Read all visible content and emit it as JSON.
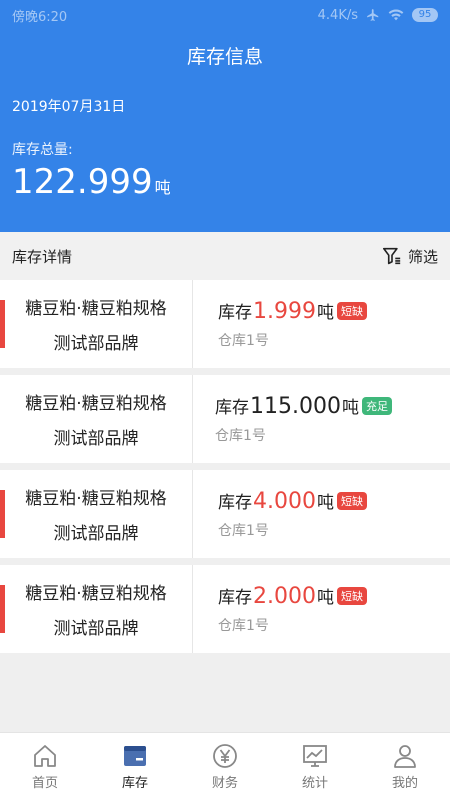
{
  "status_bar": {
    "time": "傍晚6:20",
    "net_speed": "4.4K/s",
    "battery": "95"
  },
  "header": {
    "title": "库存信息",
    "date": "2019年07月31日",
    "total_label": "库存总量:",
    "total_value": "122.999",
    "total_unit": "吨"
  },
  "section": {
    "title": "库存详情",
    "filter_label": "筛选"
  },
  "items": [
    {
      "name": "糖豆粕·糖豆粕规格",
      "brand": "测试部品牌",
      "stock_prefix": "库存",
      "stock": "1.999",
      "unit": "吨",
      "status": "短缺",
      "warehouse": "仓库1号"
    },
    {
      "name": "糖豆粕·糖豆粕规格",
      "brand": "测试部品牌",
      "stock_prefix": "库存",
      "stock": "115.000",
      "unit": "吨",
      "status": "充足",
      "warehouse": "仓库1号"
    },
    {
      "name": "糖豆粕·糖豆粕规格",
      "brand": "测试部品牌",
      "stock_prefix": "库存",
      "stock": "4.000",
      "unit": "吨",
      "status": "短缺",
      "warehouse": "仓库1号"
    },
    {
      "name": "糖豆粕·糖豆粕规格",
      "brand": "测试部品牌",
      "stock_prefix": "库存",
      "stock": "2.000",
      "unit": "吨",
      "status": "短缺",
      "warehouse": "仓库1号"
    }
  ],
  "nav": [
    {
      "label": "首页",
      "icon": "home-icon"
    },
    {
      "label": "库存",
      "icon": "inventory-icon"
    },
    {
      "label": "财务",
      "icon": "yuan-icon"
    },
    {
      "label": "统计",
      "icon": "chart-icon"
    },
    {
      "label": "我的",
      "icon": "user-icon"
    }
  ],
  "colors": {
    "primary": "#3483e8",
    "shortage": "#e8473f",
    "sufficient": "#3fb77a"
  }
}
